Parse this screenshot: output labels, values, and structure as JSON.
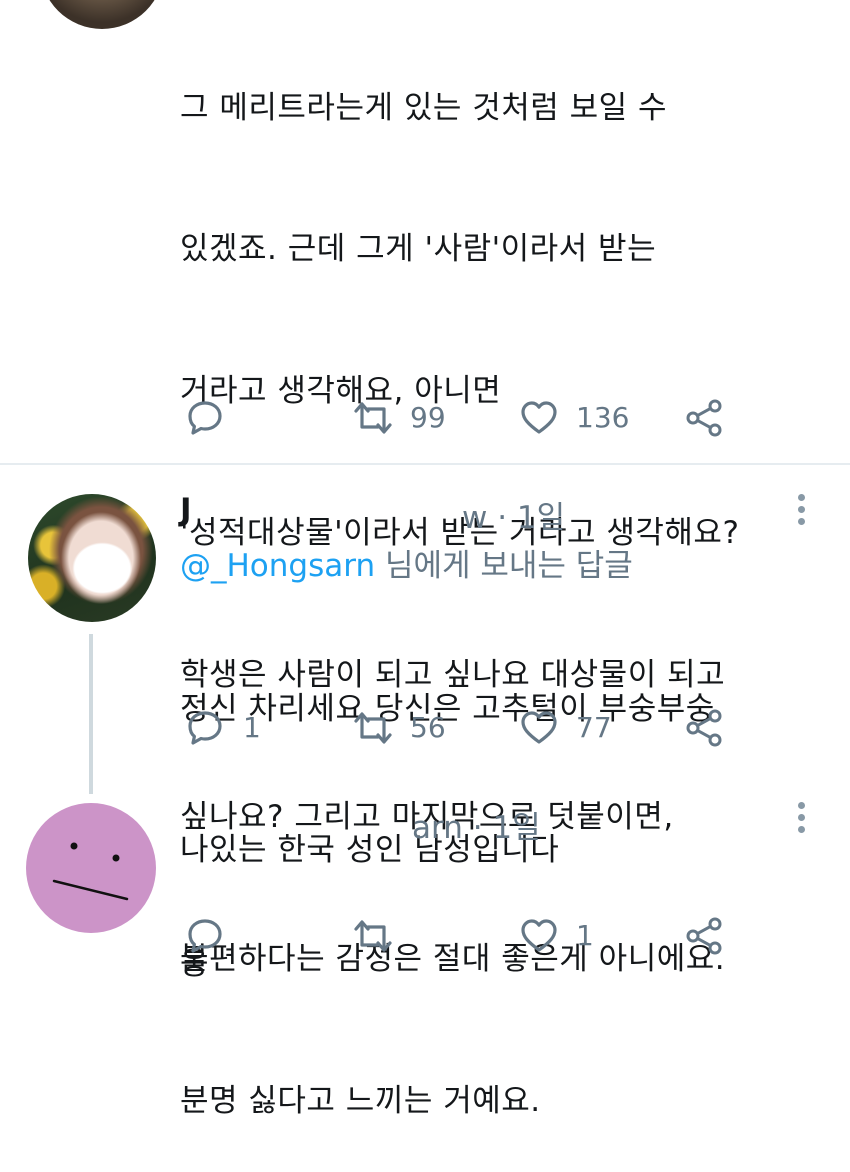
{
  "tweet1": {
    "lines": [
      "그 메리트라는게 있는 것처럼 보일 수",
      "있겠죠. 근데 그게 '사람'이라서 받는",
      "거라고 생각해요, 아니면",
      "'성적대상물'이라서 받는 거라고 생각해요?",
      "학생은 사람이 되고 싶나요 대상물이 되고",
      "싶나요? 그리고 마지막으로 덧붙이면,",
      "불편하다는 감정은 절대 좋은게 아니에요.",
      "분명 싫다고 느끼는 거예요."
    ],
    "retweets": "99",
    "likes": "136"
  },
  "tweet2": {
    "name_partial": "J",
    "handle_partial": "w",
    "time": "· 1일",
    "reply_mention": "@_Hongsarn",
    "reply_suffix": " 님에게 보내는 답글",
    "lines": [
      "정신 차리세요 당신은 고추털이 부숭부숭",
      "나있는 한국 성인 남성입니다"
    ],
    "replies": "1",
    "retweets": "56",
    "likes": "77"
  },
  "tweet3": {
    "handle_partial": "arn",
    "time": "· 1일",
    "text": "웅",
    "likes": "1"
  },
  "colors": {
    "accent": "#1da1f2",
    "muted": "#657786",
    "divider": "#e6ecf0"
  }
}
